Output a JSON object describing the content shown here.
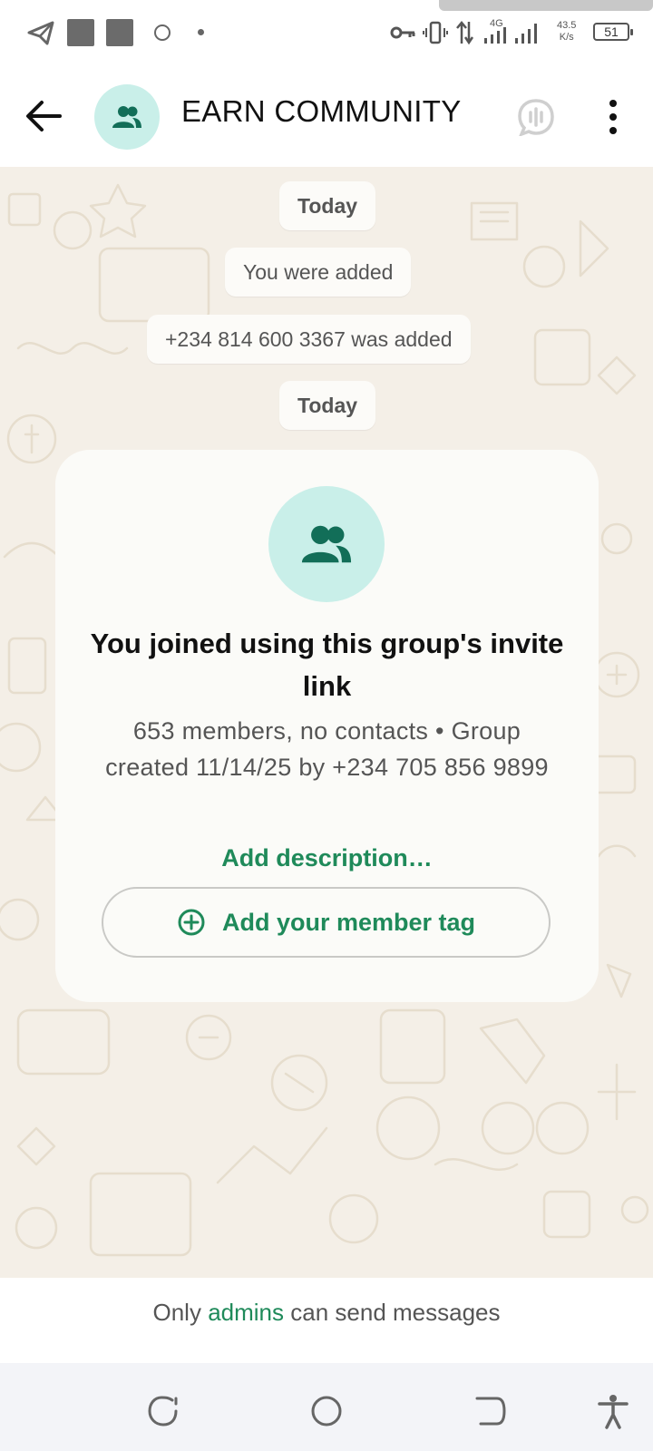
{
  "status_bar": {
    "net_type": "4G",
    "net_speed_value": "43.5",
    "net_speed_unit": "K/s",
    "battery": "51"
  },
  "header": {
    "title": "EARN COMMUNITY"
  },
  "chat": {
    "system_messages": [
      {
        "text": "Today"
      },
      {
        "text": "You were added"
      },
      {
        "text": "+234 814 600 3367 was added"
      },
      {
        "text": "Today"
      }
    ],
    "group_card": {
      "title": "You joined using this group's invite link",
      "meta": "653 members, no contacts • Group created 11/14/25 by +234 705 856 9899",
      "description_link": "Add description…",
      "member_tag_button": "Add your member tag"
    }
  },
  "footer": {
    "prefix": "Only",
    "link": "admins",
    "suffix": "can send messages"
  },
  "colors": {
    "accent": "#1f8a5a",
    "avatar_bg": "#c9efe9",
    "avatar_icon": "#126e58",
    "chat_bg": "#f4efe7"
  }
}
